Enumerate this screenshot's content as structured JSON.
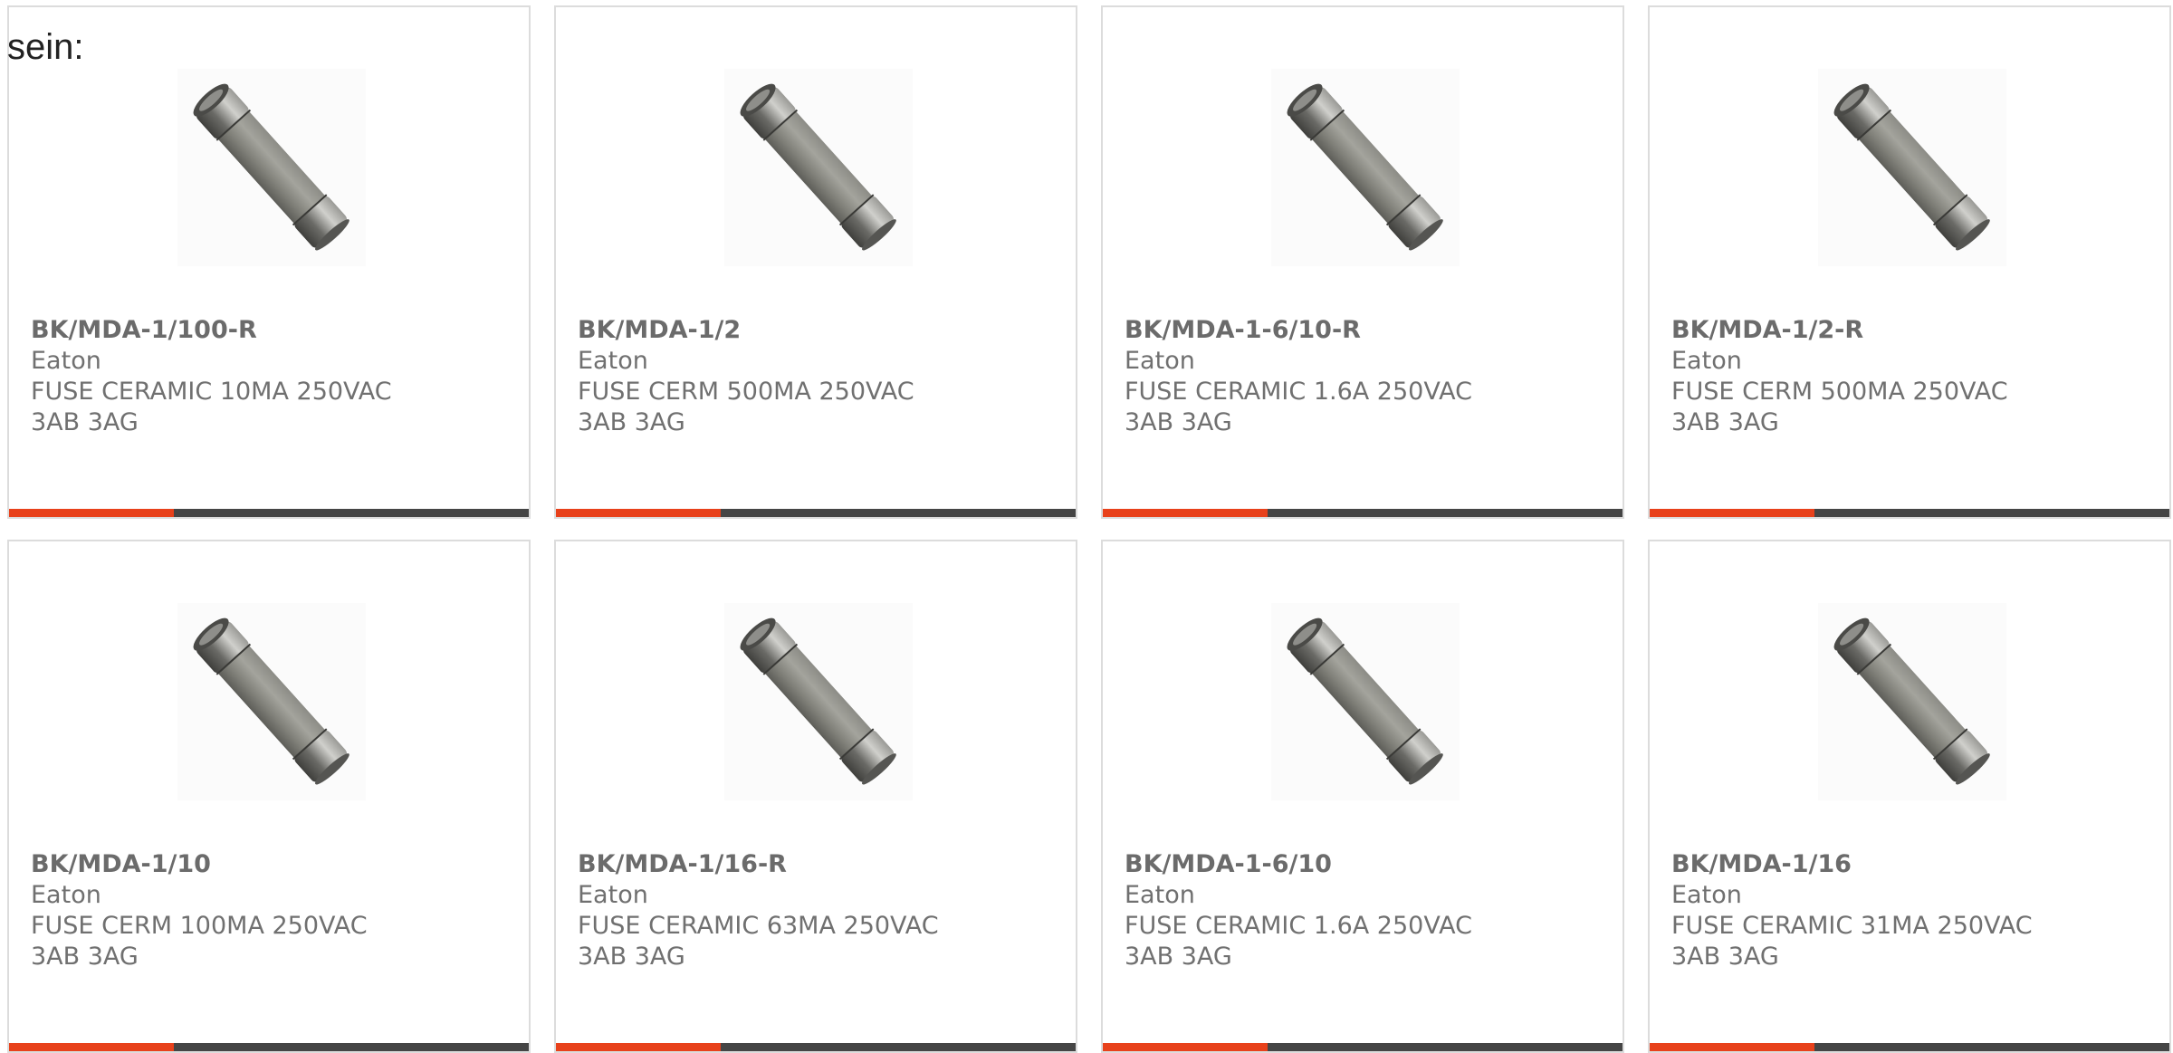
{
  "intro_text": "sein:",
  "accent_color": "#e8411b",
  "products": [
    {
      "part_number": "BK/MDA-1/100-R",
      "manufacturer": "Eaton",
      "description": "FUSE CERAMIC 10MA 250VAC 3AB 3AG",
      "image": "ceramic-fuse-photo"
    },
    {
      "part_number": "BK/MDA-1/2",
      "manufacturer": "Eaton",
      "description": "FUSE CERM 500MA 250VAC 3AB 3AG",
      "image": "ceramic-fuse-photo"
    },
    {
      "part_number": "BK/MDA-1-6/10-R",
      "manufacturer": "Eaton",
      "description": "FUSE CERAMIC 1.6A 250VAC 3AB 3AG",
      "image": "ceramic-fuse-photo"
    },
    {
      "part_number": "BK/MDA-1/2-R",
      "manufacturer": "Eaton",
      "description": "FUSE CERM 500MA 250VAC 3AB 3AG",
      "image": "ceramic-fuse-photo"
    },
    {
      "part_number": "BK/MDA-1/10",
      "manufacturer": "Eaton",
      "description": "FUSE CERM 100MA 250VAC 3AB 3AG",
      "image": "ceramic-fuse-photo"
    },
    {
      "part_number": "BK/MDA-1/16-R",
      "manufacturer": "Eaton",
      "description": "FUSE CERAMIC 63MA 250VAC 3AB 3AG",
      "image": "ceramic-fuse-photo"
    },
    {
      "part_number": "BK/MDA-1-6/10",
      "manufacturer": "Eaton",
      "description": "FUSE CERAMIC 1.6A 250VAC 3AB 3AG",
      "image": "ceramic-fuse-photo"
    },
    {
      "part_number": "BK/MDA-1/16",
      "manufacturer": "Eaton",
      "description": "FUSE CERAMIC 31MA 250VAC 3AB 3AG",
      "image": "ceramic-fuse-photo"
    }
  ]
}
